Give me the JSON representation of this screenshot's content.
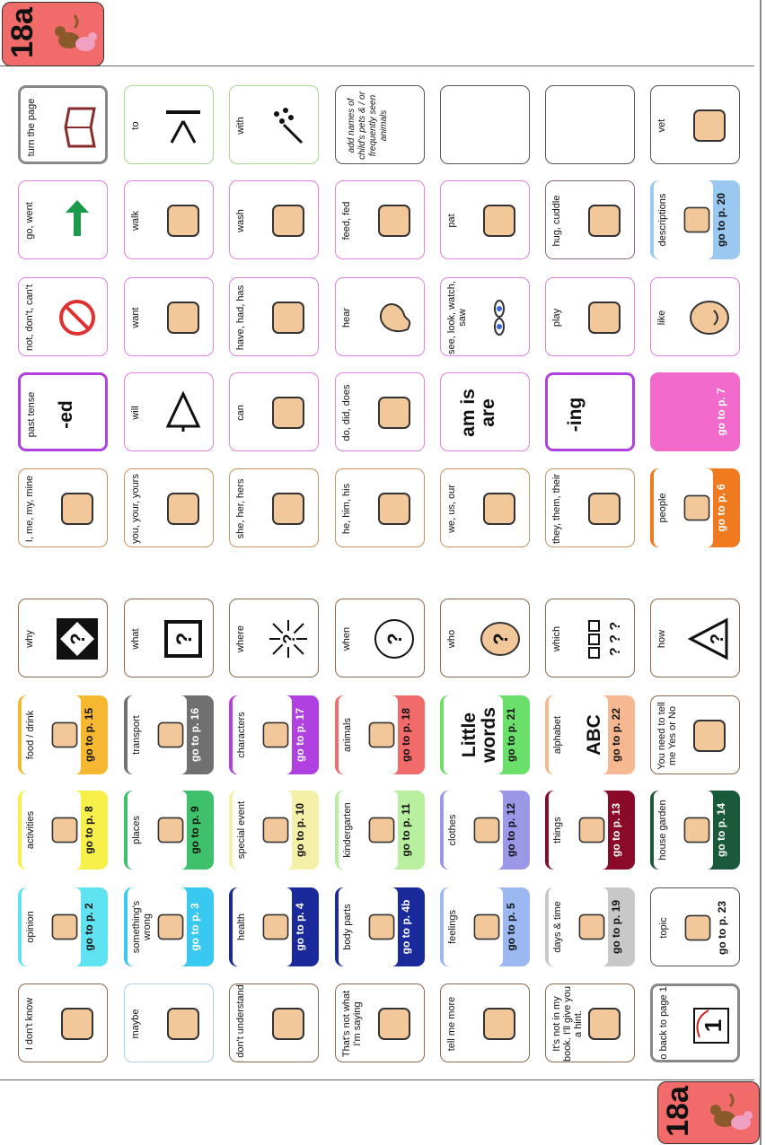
{
  "page": {
    "tab_label": "18a",
    "colors": {
      "tab": "#f26b6b",
      "border_default": "#c8935a",
      "border_pink": "#e080e0",
      "border_green": "#a8d890"
    }
  },
  "cells": [
    {
      "label": "I don't know",
      "icon": "shrug-person-icon",
      "border": "#8a6a4a"
    },
    {
      "label": "maybe",
      "icon": "balance-hands-icon",
      "border": "#a8d0e8"
    },
    {
      "label": "I don't understand",
      "icon": "confused-face-icon",
      "border": "#8a6a4a"
    },
    {
      "label": "That's not what I'm saying",
      "icon": "crossed-speech-icon",
      "border": "#8a6a4a"
    },
    {
      "label": "tell me more",
      "icon": "people-talking-icon",
      "border": "#8a6a4a"
    },
    {
      "label": "It's not in my book. I'll give you a hint.",
      "icon": "crossed-book-icon",
      "border": "#8a6a4a"
    },
    {
      "label": "go back to page 1",
      "icon": "page-one-icon",
      "border": "#888888",
      "thick": true
    },
    {
      "label": "opinion",
      "icon": "thinking-person-icon",
      "category": true,
      "go": "go to p. 2",
      "color": "#5fe3f0"
    },
    {
      "label": "something's wrong",
      "icon": "sad-face-icon",
      "category": true,
      "go": "go to p. 3",
      "color": "#38c8f0",
      "white_go": true
    },
    {
      "label": "health",
      "icon": "caduceus-icon",
      "category": true,
      "go": "go to p. 4",
      "color": "#1a2a9a",
      "white_go": true
    },
    {
      "label": "body parts",
      "icon": "ear-nose-icon",
      "category": true,
      "go": "go to p. 4b",
      "color": "#1a2a9a",
      "white_go": true
    },
    {
      "label": "feelings",
      "icon": "faces-icon",
      "category": true,
      "go": "go to p. 5",
      "color": "#9bb8f0"
    },
    {
      "label": "days & time",
      "icon": "clock-sun-icon",
      "category": true,
      "go": "go to p. 19",
      "color": "#c8c8c8"
    },
    {
      "label": "topic",
      "icon": "topic-icon",
      "category": true,
      "go": "go to p. 23",
      "color": "#ffffff",
      "border": "#555555"
    },
    {
      "label": "activities",
      "icon": "blocks-icon",
      "category": true,
      "go": "go to p. 8",
      "color": "#f7f04a"
    },
    {
      "label": "places",
      "icon": "place-question-icon",
      "category": true,
      "go": "go to p. 9",
      "color": "#3fc06a"
    },
    {
      "label": "special event",
      "icon": "star-burst-icon",
      "category": true,
      "go": "go to p. 10",
      "color": "#f5f0a8"
    },
    {
      "label": "kindergarten",
      "icon": "building-icon",
      "category": true,
      "go": "go to p. 11",
      "color": "#b8f0a0"
    },
    {
      "label": "clothes",
      "icon": "shirt-pants-icon",
      "category": true,
      "go": "go to p. 12",
      "color": "#9b98e8"
    },
    {
      "label": "things",
      "icon": "blob-icon",
      "category": true,
      "go": "go to p. 13",
      "color": "#8a0a2a",
      "white_go": true
    },
    {
      "label": "house garden",
      "icon": "house-icon",
      "category": true,
      "go": "go to p. 14",
      "color": "#1a5a3a",
      "white_go": true
    },
    {
      "label": "food / drink",
      "icon": "burger-cup-icon",
      "category": true,
      "go": "go to p. 15",
      "color": "#f5b830"
    },
    {
      "label": "transport",
      "icon": "vehicles-icon",
      "category": true,
      "go": "go to p. 16",
      "color": "#707070",
      "white_go": true
    },
    {
      "label": "characters",
      "icon": "characters-icon",
      "category": true,
      "go": "go to p. 17",
      "color": "#b040e0",
      "white_go": true
    },
    {
      "label": "animals",
      "icon": "animals-icon",
      "category": true,
      "go": "go to p. 18",
      "color": "#f26b6b"
    },
    {
      "label": "Little words",
      "big": "Little words",
      "category": true,
      "go": "go to p. 21",
      "color": "#6ae06a"
    },
    {
      "label": "alphabet",
      "big": "ABC",
      "category": true,
      "go": "go to p. 22",
      "color": "#f5b890"
    },
    {
      "label": "You need to tell me Yes or No",
      "icon": "yes-no-icon",
      "border": "#8a6a4a"
    },
    {
      "label": "why",
      "icon": "diamond-question-icon",
      "border": "#8a6a4a"
    },
    {
      "label": "what",
      "icon": "box-question-icon",
      "border": "#8a6a4a"
    },
    {
      "label": "where",
      "icon": "arrows-question-icon",
      "border": "#8a6a4a"
    },
    {
      "label": "when",
      "icon": "clock-question-icon",
      "border": "#8a6a4a"
    },
    {
      "label": "who",
      "icon": "head-question-icon",
      "border": "#8a6a4a"
    },
    {
      "label": "which",
      "icon": "squares-question-icon",
      "border": "#8a6a4a"
    },
    {
      "label": "how",
      "icon": "triangle-question-icon",
      "border": "#8a6a4a"
    },
    {
      "label": "I, me, my, mine",
      "icon": "self-person-icon",
      "border": "#c8935a"
    },
    {
      "label": "you, your, yours",
      "icon": "pointing-hand-icon",
      "border": "#c8935a"
    },
    {
      "label": "she, her, hers",
      "icon": "girl-face-icon",
      "border": "#c8935a"
    },
    {
      "label": "he, him, his",
      "icon": "boy-face-icon",
      "border": "#c8935a"
    },
    {
      "label": "we, us, our",
      "icon": "two-faces-icon",
      "border": "#c8935a"
    },
    {
      "label": "they, them, their",
      "icon": "group-faces-icon",
      "border": "#c8935a"
    },
    {
      "label": "people",
      "icon": "people-icon",
      "category": true,
      "go": "go to p. 6",
      "color": "#f07a20",
      "white_go": true
    },
    {
      "label": "past tense",
      "big": "-ed",
      "border": "#b040e0",
      "thick": true
    },
    {
      "label": "will",
      "icon": "arrow-up-icon",
      "border": "#e080e0"
    },
    {
      "label": "can",
      "icon": "strong-arm-icon",
      "border": "#e080e0"
    },
    {
      "label": "do, did, does",
      "icon": "working-hands-icon",
      "border": "#e080e0"
    },
    {
      "label": "",
      "big": "am is are",
      "border": "#e080e0"
    },
    {
      "label": "",
      "big": "-ing",
      "border": "#b040e0",
      "thick": true
    },
    {
      "label": "",
      "icon": "",
      "category": true,
      "go": "go to p. 7",
      "color": "#f26bcc",
      "white_go": true,
      "blank": true
    },
    {
      "label": "not, don't, can't",
      "icon": "no-sign-icon",
      "border": "#e080e0"
    },
    {
      "label": "want",
      "icon": "want-hands-icon",
      "border": "#e080e0"
    },
    {
      "label": "have, had, has",
      "icon": "holding-hand-icon",
      "border": "#e080e0"
    },
    {
      "label": "hear",
      "icon": "ear-icon",
      "border": "#e080e0"
    },
    {
      "label": "see, look, watch, saw",
      "icon": "eyes-icon",
      "border": "#e080e0"
    },
    {
      "label": "play",
      "icon": "playing-child-icon",
      "border": "#e080e0"
    },
    {
      "label": "like",
      "icon": "smile-face-icon",
      "border": "#e080e0"
    },
    {
      "label": "go, went",
      "icon": "green-arrow-icon",
      "border": "#e080e0"
    },
    {
      "label": "walk",
      "icon": "walking-person-icon",
      "border": "#e080e0"
    },
    {
      "label": "wash",
      "icon": "washing-icon",
      "border": "#e080e0"
    },
    {
      "label": "feed, fed",
      "icon": "feeding-icon",
      "border": "#e080e0"
    },
    {
      "label": "pat",
      "icon": "patting-hand-icon",
      "border": "#e080e0"
    },
    {
      "label": "hug, cuddle",
      "icon": "hugging-icon",
      "border": "#8a6a8a"
    },
    {
      "label": "descriptions",
      "icon": "description-icon",
      "category": true,
      "go": "go to p. 20",
      "color": "#9bc8f0"
    },
    {
      "label": "turn the page",
      "icon": "open-book-icon",
      "border": "#888888",
      "thick": true
    },
    {
      "label": "to",
      "icon": "arrows-to-line-icon",
      "border": "#a8d890"
    },
    {
      "label": "with",
      "icon": "arrow-with-dots-icon",
      "border": "#a8d890"
    },
    {
      "label": "add names of child's pets & / or frequently seen animals",
      "italic": true,
      "border": "#555555"
    },
    {
      "label": "",
      "border": "#555555"
    },
    {
      "label": "",
      "border": "#555555"
    },
    {
      "label": "vet",
      "icon": "vet-icon",
      "border": "#555555"
    }
  ]
}
